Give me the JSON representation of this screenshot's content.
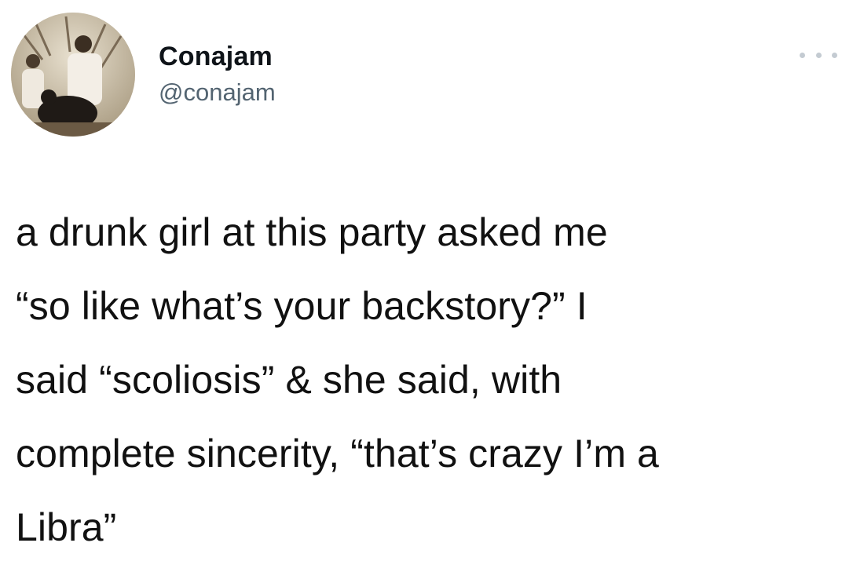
{
  "author": {
    "display_name": "Conajam",
    "handle": "@conajam",
    "avatar_icon": "profile-photo"
  },
  "menu": {
    "icon": "more-options-icon"
  },
  "tweet": {
    "lines": [
      "a drunk girl at this party asked me",
      "“so like what’s your backstory?” I",
      "said “scoliosis” & she said, with",
      "complete sincerity, “that’s crazy I’m a",
      "Libra”"
    ]
  },
  "colors": {
    "name": "#0f1419",
    "handle": "#536471",
    "body_text": "#111111",
    "background": "#ffffff"
  }
}
